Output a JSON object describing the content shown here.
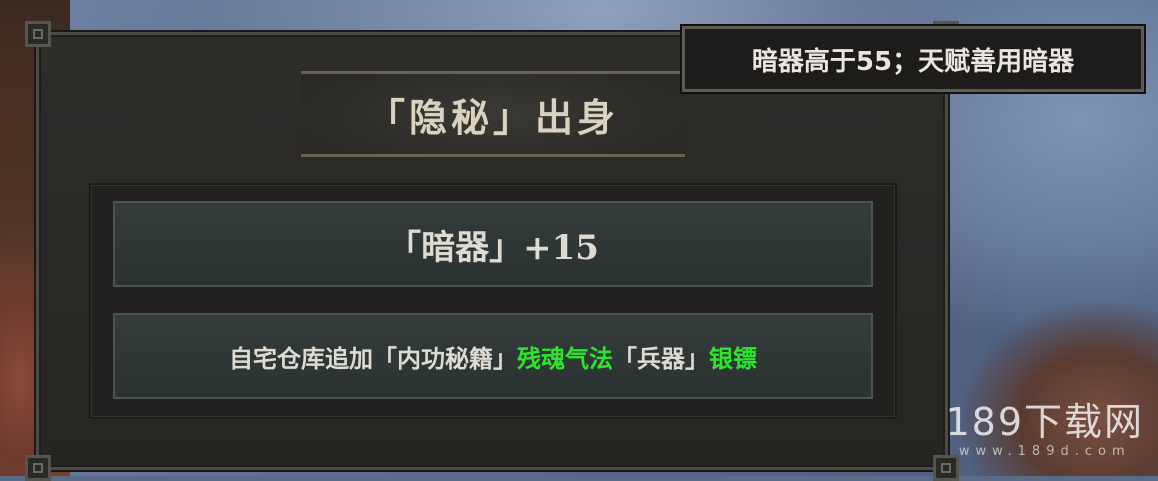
{
  "panel": {
    "title": "「隐秘」出身",
    "bonus": "「暗器」+15",
    "reward": {
      "prefix": "自宅仓库追加「内功秘籍」",
      "item1": "残魂气法",
      "middle": "「兵器」",
      "item2": "银镖"
    }
  },
  "tooltip": {
    "text": "暗器高于55；天赋善用暗器"
  },
  "watermark": {
    "main": "189下载网",
    "sub": "www.189d.com"
  },
  "colors": {
    "highlight": "#2ee52e",
    "text": "#dedbd2",
    "panel_bg": "#2a2926"
  }
}
